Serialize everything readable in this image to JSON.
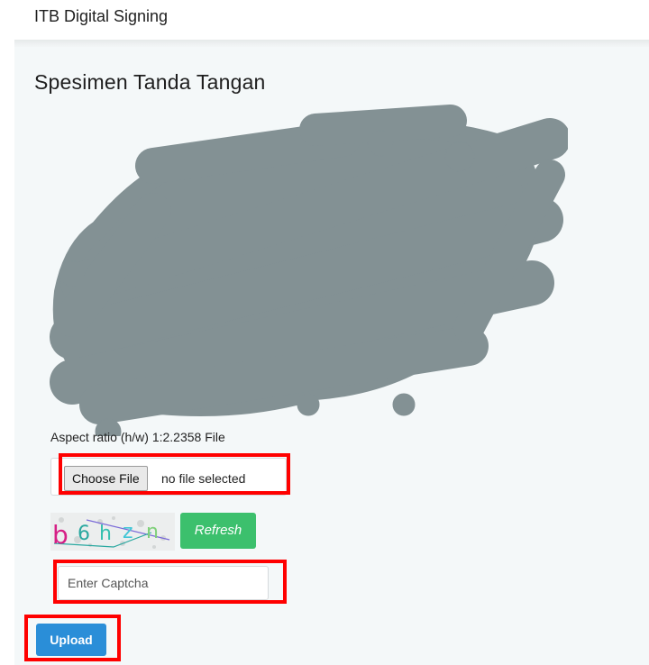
{
  "header": {
    "app_title": "ITB Digital Signing"
  },
  "panel": {
    "title": "Spesimen Tanda Tangan",
    "aspect_ratio_text": "Aspect ratio (h/w) 1:2.2358 File"
  },
  "file_input": {
    "button_label": "Choose File",
    "status": "no file selected"
  },
  "captcha": {
    "characters": [
      "b",
      "6",
      "h",
      "z",
      "n"
    ],
    "refresh_label": "Refresh",
    "input_placeholder": "Enter Captcha"
  },
  "actions": {
    "upload_label": "Upload"
  },
  "colors": {
    "signature_redaction": "#839194",
    "panel_background": "#f4f8f9",
    "highlight_outline": "#ff0000",
    "refresh_button": "#3cc06d",
    "upload_button": "#2a8ed8"
  }
}
